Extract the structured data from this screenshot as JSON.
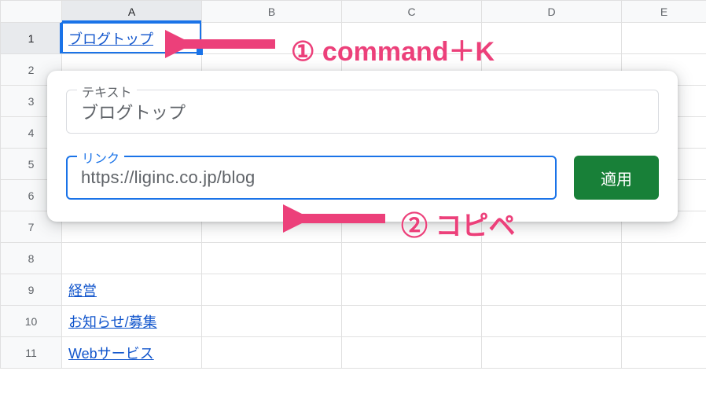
{
  "columns": [
    "A",
    "B",
    "C",
    "D",
    "E"
  ],
  "rows": [
    "1",
    "2",
    "3",
    "4",
    "5",
    "6",
    "7",
    "8",
    "9",
    "10",
    "11"
  ],
  "cells": {
    "A1": "ブログトップ",
    "A8": "",
    "A9": "経営",
    "A10": "お知らせ/募集",
    "A11": "Webサービス"
  },
  "link_cells": [
    "A1",
    "A8",
    "A9",
    "A10",
    "A11"
  ],
  "selected_cell": "A1",
  "dialog": {
    "text_label": "テキスト",
    "text_value": "ブログトップ",
    "link_label": "リンク",
    "link_value": "https://liginc.co.jp/blog",
    "apply_label": "適用"
  },
  "annotations": {
    "step1": "① command＋K",
    "step2": "② コピペ"
  },
  "colors": {
    "accent": "#1a73e8",
    "apply": "#188038",
    "annotation": "#ec407a"
  }
}
